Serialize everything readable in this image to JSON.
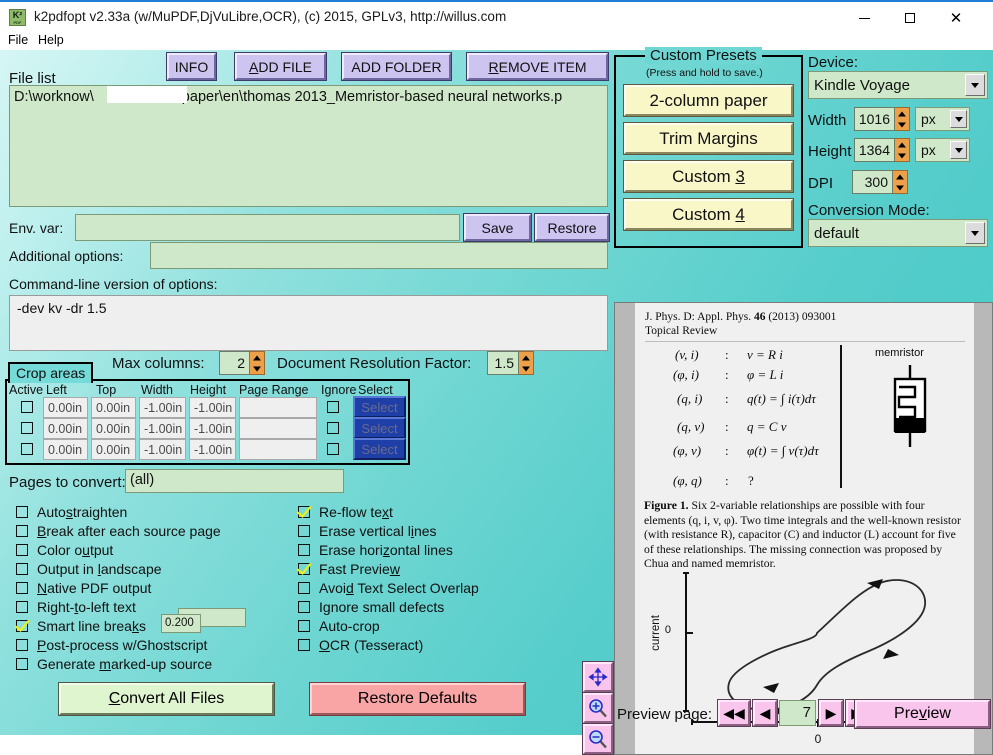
{
  "window": {
    "title": "k2pdfopt v2.33a (w/MuPDF,DjVuLibre,OCR), (c) 2015, GPLv3, http://willus.com",
    "icon_main": "K²",
    "icon_sub": "PDF",
    "minimize": "−",
    "maximize": "□",
    "close": "✕"
  },
  "menubar": {
    "file": "File",
    "help": "Help"
  },
  "filelist": {
    "label": "File list",
    "buttons": [
      {
        "name": "info",
        "label": "INFO"
      },
      {
        "name": "add-file",
        "label": "ADD FILE",
        "accel": "A"
      },
      {
        "name": "add-folder",
        "label": "ADD FOLDER"
      },
      {
        "name": "remove-item",
        "label": "REMOVE ITEM",
        "accel": "R"
      }
    ],
    "entry_prefix": "D:\\worknow\\",
    "entry_suffix": "\\paper\\en\\thomas 2013_Memristor-based neural networks.p"
  },
  "envvar": {
    "label": "Env. var:",
    "value": "",
    "save_label": "Save",
    "restore_label": "Restore"
  },
  "additional_options": {
    "label": "Additional options:",
    "value": ""
  },
  "commandline": {
    "label": "Command-line version of options:",
    "value": "-dev kv -dr 1.5"
  },
  "max_columns": {
    "label": "Max columns:",
    "value": "2"
  },
  "doc_res_factor": {
    "label": "Document Resolution Factor:",
    "value": "1.5"
  },
  "crop": {
    "group_title": "Crop areas",
    "headers": [
      "Active",
      "Left",
      "Top",
      "Width",
      "Height",
      "Page Range",
      "Ignore",
      "Select"
    ],
    "rows": [
      {
        "active": false,
        "left": "0.00in",
        "top": "0.00in",
        "width": "-1.00in",
        "height": "-1.00in",
        "page_range": "",
        "ignore": false,
        "select": "Select"
      },
      {
        "active": false,
        "left": "0.00in",
        "top": "0.00in",
        "width": "-1.00in",
        "height": "-1.00in",
        "page_range": "",
        "ignore": false,
        "select": "Select"
      },
      {
        "active": false,
        "left": "0.00in",
        "top": "0.00in",
        "width": "-1.00in",
        "height": "-1.00in",
        "page_range": "",
        "ignore": false,
        "select": "Select"
      }
    ]
  },
  "pages_to_convert": {
    "label": "Pages to convert:",
    "value": "(all)"
  },
  "options_left": [
    {
      "label": "Autostraighten",
      "checked": false,
      "accel": "s"
    },
    {
      "label": "Break after each source page",
      "checked": false,
      "accel": "B"
    },
    {
      "label": "Color output",
      "checked": false,
      "accel": "u"
    },
    {
      "label": "Output in landscape",
      "checked": false,
      "accel": "l",
      "field": ""
    },
    {
      "label": "Native PDF output",
      "checked": false,
      "accel": "N"
    },
    {
      "label": "Right-to-left text",
      "checked": false,
      "accel": "t"
    },
    {
      "label": "Smart line breaks",
      "checked": true,
      "accel": "k",
      "field": "0.200"
    },
    {
      "label": "Post-process w/Ghostscript",
      "checked": false,
      "accel": "P"
    },
    {
      "label": "Generate marked-up source",
      "checked": false,
      "accel": "m"
    }
  ],
  "options_right": [
    {
      "label": "Re-flow text",
      "checked": true,
      "accel": "x"
    },
    {
      "label": "Erase vertical lines",
      "checked": false,
      "accel": "i"
    },
    {
      "label": "Erase horizontal lines",
      "checked": false,
      "accel": "z"
    },
    {
      "label": "Fast Preview",
      "checked": true,
      "accel": "w"
    },
    {
      "label": "Avoid Text Select Overlap",
      "checked": false,
      "accel": "d"
    },
    {
      "label": "Ignore small defects",
      "checked": false,
      "accel": "g"
    },
    {
      "label": "Auto-crop",
      "checked": false
    },
    {
      "label": "OCR (Tesseract)",
      "checked": false,
      "accel": "O"
    }
  ],
  "actions": {
    "convert": "Convert All Files",
    "convert_accel": "C",
    "restore_defaults": "Restore Defaults"
  },
  "presets": {
    "group_title": "Custom Presets",
    "hint": "(Press and hold to save.)",
    "items": [
      {
        "label": "2-column paper"
      },
      {
        "label": "Trim Margins"
      },
      {
        "label": "Custom 3",
        "accel": "3"
      },
      {
        "label": "Custom 4",
        "accel": "4"
      }
    ]
  },
  "device": {
    "label": "Device:",
    "value": "Kindle Voyage",
    "width_label": "Width",
    "width_value": "1016",
    "width_unit": "px",
    "height_label": "Height",
    "height_value": "1364",
    "height_unit": "px",
    "dpi_label": "DPI",
    "dpi_value": "300",
    "conversion_mode_label": "Conversion Mode:",
    "conversion_mode_value": "default"
  },
  "preview": {
    "journal_line1": "J. Phys. D: Appl. Phys. ",
    "journal_vol": "46",
    "journal_line1b": " (2013) 093001",
    "journal_line2": "Topical Review",
    "relations": [
      {
        "pair": "(v, i)",
        "colon": ":",
        "eq": "v = R i"
      },
      {
        "pair": "(φ, i)",
        "colon": ":",
        "eq": "φ = L i"
      },
      {
        "pair": "(q, i)",
        "colon": ":",
        "eq": "q(t) = ∫ i(τ)dτ"
      },
      {
        "pair": "(q, v)",
        "colon": ":",
        "eq": "q = C v"
      },
      {
        "pair": "(φ, v)",
        "colon": ":",
        "eq": "φ(t) = ∫ v(τ)dτ"
      },
      {
        "pair": "(φ, q)",
        "colon": ":",
        "eq": "?"
      }
    ],
    "memristor_label": "memristor",
    "caption_bold": "Figure 1.",
    "caption": " Six 2-variable relationships are possible with four elements (q, i, v, φ). Two time integrals and the well-known resistor (with resistance R), capacitor (C) and inductor (L) account for five of these relationships. The missing connection was proposed by Chua and named memristor.",
    "chart_ylabel": "current",
    "chart_yzero": "0",
    "chart_xzero": "0",
    "page_label": "Preview page:",
    "page_value": "7",
    "first_icon": "◀◀",
    "prev_icon": "◀",
    "next_icon": "▶",
    "last_icon": "▶▶",
    "preview_button": "Preview",
    "preview_accel": "v",
    "tool_pan": "pan-icon",
    "tool_zoom_in": "zoom-in-icon",
    "tool_zoom_out": "zoom-out-icon"
  },
  "chart_data": {
    "type": "line",
    "title": "",
    "xlabel": "",
    "ylabel": "current",
    "xticks": [
      "0"
    ],
    "yticks": [
      "0"
    ],
    "description": "Pinched hysteresis loop (figure-eight / lissajous) of a memristor current-voltage characteristic with direction arrows",
    "series": [
      {
        "name": "memristor i-v loop",
        "x": [],
        "values": []
      }
    ]
  }
}
